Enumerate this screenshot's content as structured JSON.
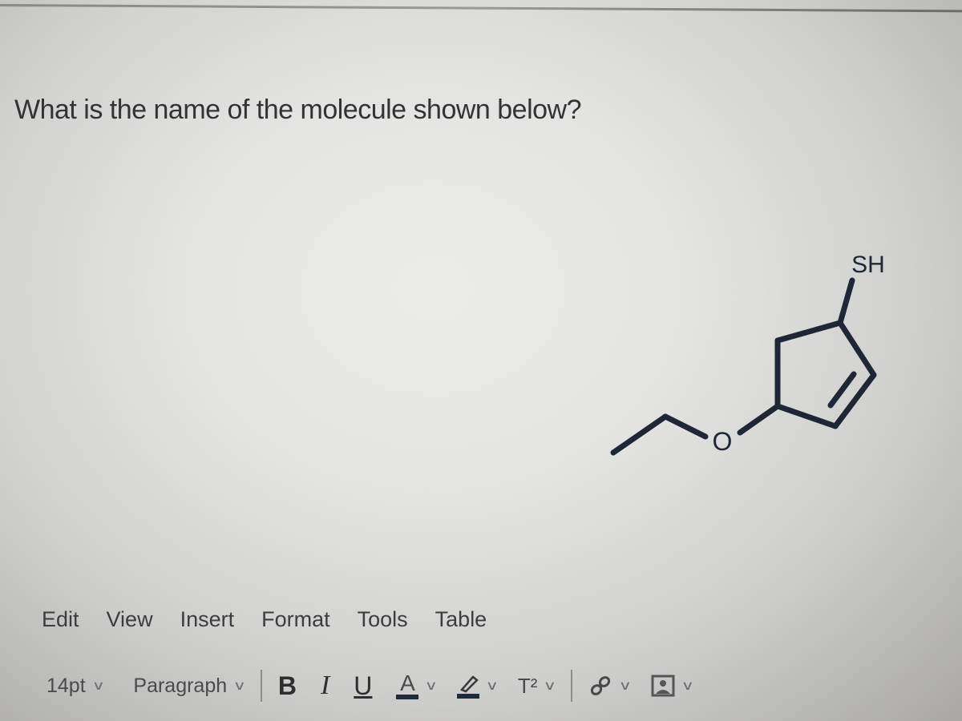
{
  "question": {
    "text": "What is the name of the molecule shown below?"
  },
  "molecule": {
    "substituent_labels": {
      "thiol": "SH",
      "oxygen": "O"
    },
    "description": "cyclopentene ring with SH and ethoxy (O-CH2CH3) substituents"
  },
  "menubar": {
    "items": [
      {
        "label": "Edit"
      },
      {
        "label": "View"
      },
      {
        "label": "Insert"
      },
      {
        "label": "Format"
      },
      {
        "label": "Tools"
      },
      {
        "label": "Table"
      }
    ]
  },
  "toolbar": {
    "font_size": "14pt",
    "block_format": "Paragraph",
    "bold_label": "B",
    "italic_label": "I",
    "underline_label": "U",
    "text_color_label": "A",
    "superscript_label": "T²",
    "chevron": "⌄",
    "icons": {
      "highlight": "highlighter-icon",
      "link": "link-icon",
      "image": "image-icon"
    }
  }
}
